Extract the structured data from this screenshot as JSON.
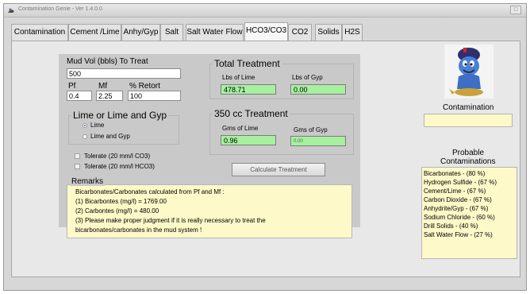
{
  "window": {
    "title": "Contamination Genie - Ver 1.4.0.0",
    "close_label": "□"
  },
  "tabs": [
    {
      "label": "Contamination",
      "active": false
    },
    {
      "label": "Cement /Lime",
      "active": false
    },
    {
      "label": "Anhy/Gyp",
      "active": false
    },
    {
      "label": "Salt",
      "active": false
    },
    {
      "label": "Salt Water Flow",
      "active": false
    },
    {
      "label": "HCO3/CO3",
      "active": true
    },
    {
      "label": "CO2",
      "active": false
    },
    {
      "label": "Solids",
      "active": false
    },
    {
      "label": "H2S",
      "active": false
    }
  ],
  "form": {
    "mud_vol_label": "Mud Vol (bbls) To Treat",
    "mud_vol_value": "500",
    "pf_label": "Pf",
    "pf_value": "0.4",
    "mf_label": "Mf",
    "mf_value": "2.25",
    "retort_label": "% Retort",
    "retort_value": "100"
  },
  "lime_group": {
    "title": "Lime or Lime and Gyp",
    "options": [
      {
        "label": "Lime",
        "selected": true
      },
      {
        "label": "Lime and Gyp",
        "selected": false
      }
    ]
  },
  "tolerate": [
    {
      "label": "Tolerate (20 mm/l CO3)",
      "checked": false
    },
    {
      "label": "Tolerate (20 mm/l HCO3)",
      "checked": false
    }
  ],
  "total_treatment": {
    "title": "Total Treatment",
    "lime_label": "Lbs of Lime",
    "lime_value": "478.71",
    "gyp_label": "Lbs of  Gyp",
    "gyp_value": "0.00"
  },
  "cc_treatment": {
    "title": "350 cc Treatment",
    "lime_label": "Gms of Lime",
    "lime_value": "0.96",
    "gyp_label": "Gms of Gyp",
    "gyp_value": "0.00"
  },
  "calculate_button": "Calculate Treatment",
  "remarks": {
    "title": "Remarks",
    "lines": [
      "Bicarbonates/Carbonates calculated from Pf and Mf :",
      "(1) Bicarbontes (mg/l) =  1769.00",
      "(2) Carbontes (mg/l) =  480.00",
      "(3) Please make proper judgment if it is really necessary to treat the",
      "      bicarbonates/carbonates in the mud system !"
    ]
  },
  "contamination": {
    "label": "Contamination",
    "value": ""
  },
  "probable": {
    "title_line1": "Probable",
    "title_line2": "Contaminations",
    "items": [
      "Bicarbonates - (80 %)",
      "Hydrogen Sulfide - (67 %)",
      "Cement/Lime - (67 %)",
      "Carbon Dioxide - (67 %)",
      "Anhydrite/Gyp - (67 %)",
      "Sodium Chloride - (60 %)",
      "Drill Solids - (40 %)",
      "Salt Water Flow - (27 %)"
    ]
  },
  "colors": {
    "green_field": "#a6f0a0",
    "yellow_field": "#fdf9c8",
    "panel_gray": "#c9c9c9"
  },
  "icons": {
    "app": "genie-app-icon",
    "genie": "genie-mascot-icon"
  }
}
